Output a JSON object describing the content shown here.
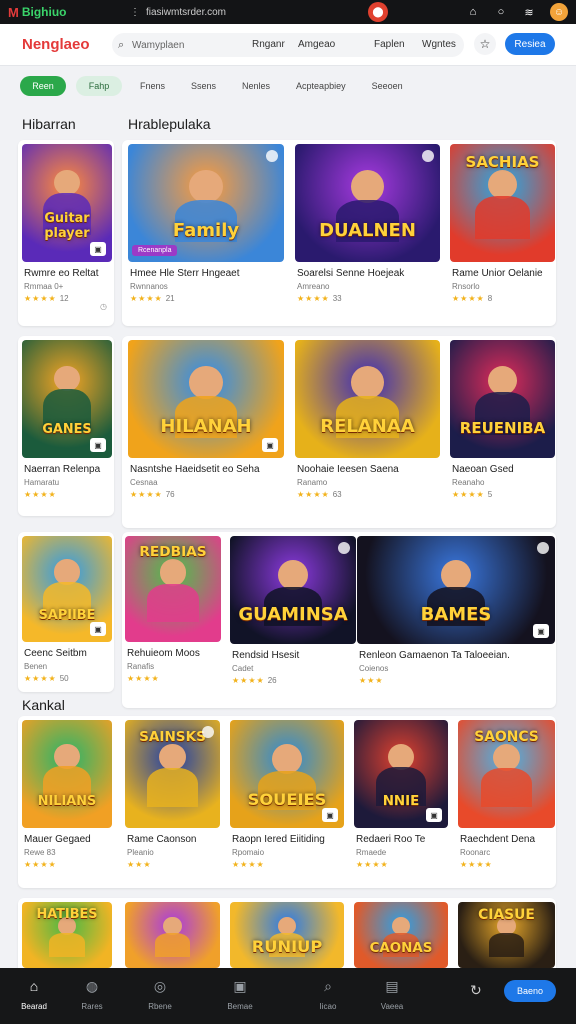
{
  "statusbar": {
    "app_name": "Bighiuo",
    "url": "fiasiwmtsrder.com",
    "icons": [
      "home-outline-icon",
      "circle-icon",
      "wifi-icon",
      "avatar-icon"
    ]
  },
  "header": {
    "brand": "Nenglaeo",
    "search_placeholder": "Wamyplaen",
    "links": [
      "Rnganr",
      "Amgeao",
      "Faplen",
      "Wgntes"
    ],
    "primary_button": "Resiea"
  },
  "chips": [
    "Reen",
    "Fahp",
    "Fnens",
    "Ssens",
    "Nenles",
    "Acpteapbiey",
    "Seeoen"
  ],
  "sections": {
    "left_title": "Hibarran",
    "right_title": "Hrablepulaka",
    "kankal_title": "Kankal"
  },
  "cards": [
    {
      "title": "Rwmre eo Reltat",
      "sub": "Rmmaa 0+",
      "rating": "★★★★",
      "num": "12",
      "extra": "◷",
      "art": "Guitar player",
      "palette": [
        "#ff8b3d",
        "#5a2ab8"
      ]
    },
    {
      "title": "Hmee Hle Sterr Hngeaet",
      "sub": "Rwnnanos",
      "rating": "★★★★",
      "num": "21",
      "art": "Family",
      "palette": [
        "#ff9c3a",
        "#3b86d8"
      ],
      "tag": "Rcenanpla"
    },
    {
      "title": "Soarelsi Senne Hoejeak",
      "sub": "Amreano",
      "rating": "★★★★",
      "num": "33",
      "art": "DUALNEN",
      "palette": [
        "#a63ae0",
        "#2a1a6e"
      ]
    },
    {
      "title": "Rame Unior Oelanie",
      "sub": "Rnsorlo",
      "rating": "★★★★",
      "num": "8",
      "art": "SACHIAS",
      "palette": [
        "#27a9e6",
        "#e13b2b"
      ]
    },
    {
      "title": "Naerran Relenpa",
      "sub": "Hamaratu",
      "rating": "★★★★",
      "num": "",
      "art": "GANES",
      "palette": [
        "#f5a524",
        "#1b5b3c"
      ]
    },
    {
      "title": "Nasntshe Haeidsetit eo Seha",
      "sub": "Cesnaa",
      "rating": "★★★★",
      "num": "76",
      "art": "HILANAH",
      "palette": [
        "#2c8cf0",
        "#f0a31b"
      ]
    },
    {
      "title": "Noohaie Ieesen Saena",
      "sub": "Ranamo",
      "rating": "★★★★",
      "num": "63",
      "art": "RELANAA",
      "palette": [
        "#3b2ab8",
        "#e6b11a"
      ]
    },
    {
      "title": "Naeoan Gsed",
      "sub": "Reanaho",
      "rating": "★★★★",
      "num": "5",
      "art": "REUENIBA",
      "palette": [
        "#e02c5a",
        "#1c1d4a"
      ]
    },
    {
      "title": "Ceenc Seitbm",
      "sub": "Benen",
      "rating": "★★★★",
      "num": "50",
      "art": "SAPIIBE",
      "palette": [
        "#2f9be8",
        "#f5b829"
      ]
    },
    {
      "title": "Rehuieom Moos",
      "sub": "Ranafis",
      "rating": "★★★★",
      "num": "",
      "art": "REDBIAS",
      "palette": [
        "#4cc14a",
        "#e23c8c"
      ]
    },
    {
      "title": "Rendsid Hsesit",
      "sub": "Cadet",
      "rating": "★★★★",
      "num": "26",
      "art": "GUAMINSA",
      "palette": [
        "#8c3ae0",
        "#111327"
      ]
    },
    {
      "title": "Renleon Gamaenon Ta Taloeeian.",
      "sub": "Coienos",
      "rating": "★★★",
      "num": "",
      "art": "BAMES",
      "palette": [
        "#3a78e0",
        "#14121f"
      ]
    },
    {
      "title": "Mauer Gegaed",
      "sub": "Rewe 83",
      "rating": "★★★★",
      "num": "",
      "art": "NILIANS",
      "palette": [
        "#28b46a",
        "#f1a024"
      ]
    },
    {
      "title": "Rame Caonson",
      "sub": "Pleanio",
      "rating": "★★★",
      "num": "",
      "art": "SAINSKS",
      "palette": [
        "#1e3ea8",
        "#e8b21e"
      ]
    },
    {
      "title": "Raopn Iered Eiitiding",
      "sub": "Rpomaio",
      "rating": "★★★★",
      "num": "",
      "art": "SOUEIES",
      "palette": [
        "#2a8ad8",
        "#e6a21a"
      ]
    },
    {
      "title": "Redaeri Roo Te",
      "sub": "Rmaede",
      "rating": "★★★★",
      "num": "",
      "art": "NNIE",
      "palette": [
        "#e0412f",
        "#1d1a3a"
      ]
    },
    {
      "title": "Raechdent Dena",
      "sub": "Roonarc",
      "rating": "★★★★",
      "num": "",
      "art": "SAONCS",
      "palette": [
        "#4ab3e8",
        "#e84a2a"
      ]
    },
    {
      "title": "",
      "sub": "",
      "rating": "",
      "num": "",
      "art": "HATIBES",
      "palette": [
        "#49b845",
        "#f1b424"
      ]
    },
    {
      "title": "",
      "sub": "",
      "rating": "",
      "num": "",
      "art": "",
      "palette": [
        "#a83ae0",
        "#f0a02a"
      ]
    },
    {
      "title": "",
      "sub": "",
      "rating": "",
      "num": "",
      "art": "RUNIUP",
      "palette": [
        "#2a7ae8",
        "#f2b82b"
      ]
    },
    {
      "title": "",
      "sub": "",
      "rating": "",
      "num": "",
      "art": "CAONAS",
      "palette": [
        "#2aa0e8",
        "#e05a2a"
      ]
    },
    {
      "title": "",
      "sub": "",
      "rating": "",
      "num": "",
      "art": "CIASUE",
      "palette": [
        "#e8a82a",
        "#2a1f14"
      ]
    }
  ],
  "bottom_nav": {
    "items": [
      {
        "label": "Bearad",
        "icon": "home-icon"
      },
      {
        "label": "Rares",
        "icon": "globe-icon"
      },
      {
        "label": "Rbene",
        "icon": "compass-icon"
      },
      {
        "label": "Bemae",
        "icon": "edit-icon"
      },
      {
        "label": "Iicao",
        "icon": "search-icon"
      },
      {
        "label": "Vaeea",
        "icon": "library-icon"
      }
    ],
    "button": "Baeno"
  }
}
